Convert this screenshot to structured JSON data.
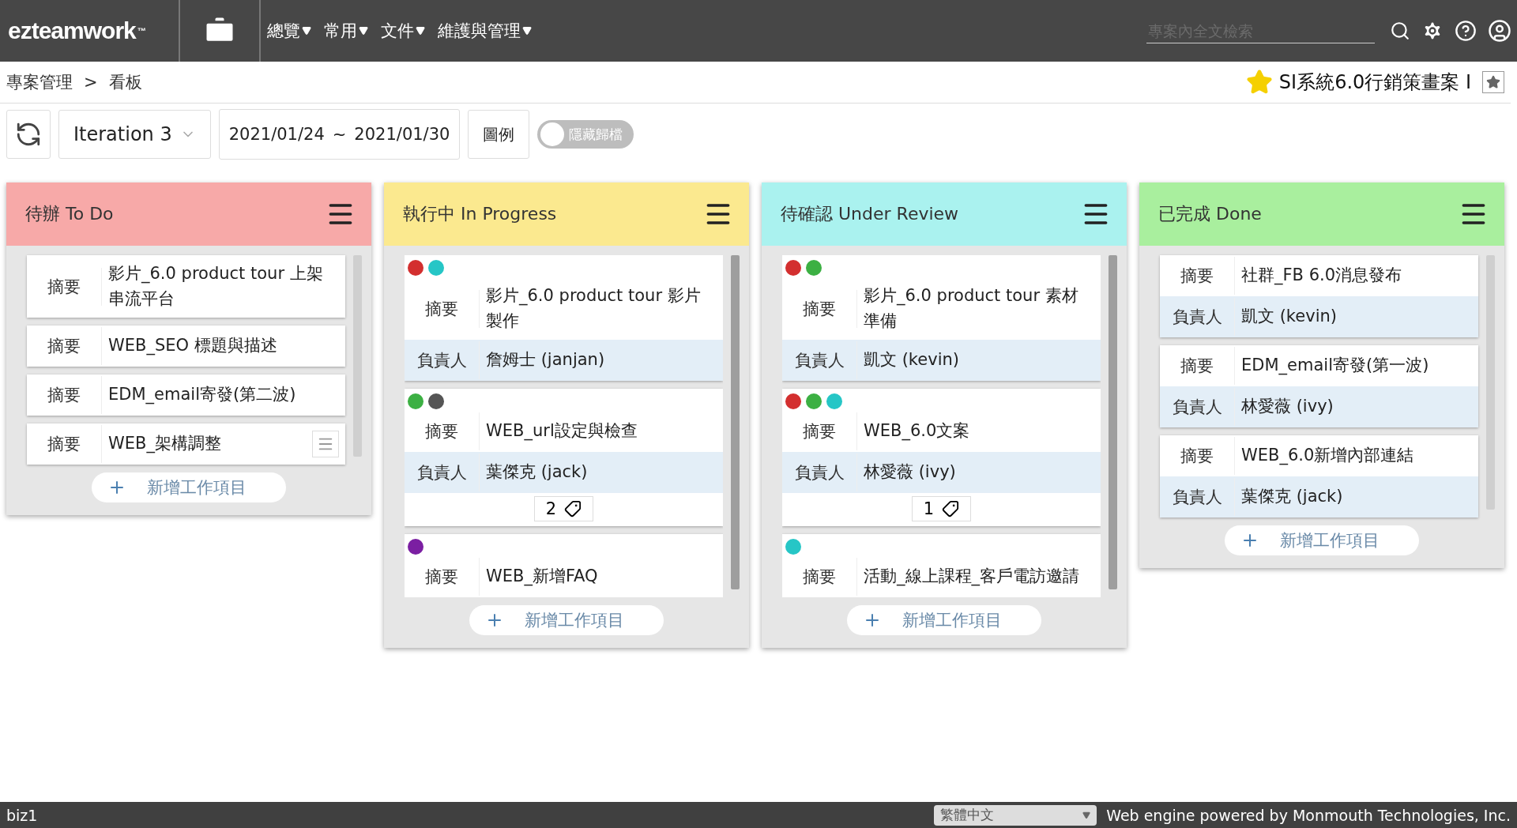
{
  "header": {
    "logo": "ezteamwork",
    "logo_mark": "™",
    "menu": [
      {
        "label": "總覽"
      },
      {
        "label": "常用"
      },
      {
        "label": "文件"
      },
      {
        "label": "維護與管理"
      }
    ],
    "search": {
      "placeholder": "專案內全文檢索"
    }
  },
  "breadcrumb": {
    "items": [
      "專案管理",
      "看板"
    ],
    "separator": ">"
  },
  "project": {
    "title": "SI系統6.0行銷策畫案 I",
    "starred": true
  },
  "toolbar": {
    "iteration": "Iteration 3",
    "date_start": "2021/01/24",
    "date_sep": "~",
    "date_end": "2021/01/30",
    "legend_button": "圖例",
    "archive_toggle": {
      "label": "隱藏歸檔",
      "on": false
    }
  },
  "columns": [
    {
      "title": "待辦 To Do",
      "color": "#f7a9a8",
      "scrolled": false,
      "add_label": "新增工作項目",
      "cards": [
        {
          "fields": [
            {
              "kind": "summary",
              "label": "摘要",
              "value": "影片_6.0 product tour 上架串流平台"
            }
          ]
        },
        {
          "fields": [
            {
              "kind": "summary",
              "label": "摘要",
              "value": "WEB_SEO 標題與描述"
            }
          ]
        },
        {
          "fields": [
            {
              "kind": "summary",
              "label": "摘要",
              "value": "EDM_email寄發(第二波)"
            }
          ]
        },
        {
          "menu": true,
          "fields": [
            {
              "kind": "summary",
              "label": "摘要",
              "value": "WEB_架構調整"
            }
          ]
        }
      ]
    },
    {
      "title": "執行中 In Progress",
      "color": "#fbe98f",
      "scrolled": true,
      "add_label": "新增工作項目",
      "cards": [
        {
          "dots": [
            {
              "color": "#d32f2f"
            },
            {
              "color": "#26c6c6"
            }
          ],
          "fields": [
            {
              "kind": "summary",
              "label": "摘要",
              "value": "影片_6.0 product tour 影片製作"
            },
            {
              "kind": "owner",
              "label": "負責人",
              "value": "詹姆士 (janjan)"
            }
          ]
        },
        {
          "dots": [
            {
              "color": "#3cb043"
            },
            {
              "color": "#555555"
            }
          ],
          "tag_count": "2",
          "fields": [
            {
              "kind": "summary",
              "label": "摘要",
              "value": "WEB_url設定與檢查"
            },
            {
              "kind": "owner",
              "label": "負責人",
              "value": "葉傑克 (jack)"
            }
          ]
        },
        {
          "dots": [
            {
              "color": "#7b1fa2"
            }
          ],
          "fields": [
            {
              "kind": "summary",
              "label": "摘要",
              "value": "WEB_新增FAQ"
            }
          ]
        }
      ]
    },
    {
      "title": "待確認 Under Review",
      "color": "#aaf2ef",
      "scrolled": true,
      "add_label": "新增工作項目",
      "cards": [
        {
          "dots": [
            {
              "color": "#d32f2f"
            },
            {
              "color": "#3cb043"
            }
          ],
          "fields": [
            {
              "kind": "summary",
              "label": "摘要",
              "value": "影片_6.0 product tour 素材準備"
            },
            {
              "kind": "owner",
              "label": "負責人",
              "value": "凱文 (kevin)"
            }
          ]
        },
        {
          "dots": [
            {
              "color": "#d32f2f"
            },
            {
              "color": "#3cb043"
            },
            {
              "color": "#26c6c6"
            }
          ],
          "tag_count": "1",
          "fields": [
            {
              "kind": "summary",
              "label": "摘要",
              "value": "WEB_6.0文案"
            },
            {
              "kind": "owner",
              "label": "負責人",
              "value": "林愛薇 (ivy)"
            }
          ]
        },
        {
          "dots": [
            {
              "color": "#26c6c6"
            }
          ],
          "fields": [
            {
              "kind": "summary",
              "label": "摘要",
              "value": "活動_線上課程_客戶電訪邀請"
            }
          ]
        }
      ]
    },
    {
      "title": "已完成 Done",
      "color": "#a9ef9e",
      "scrolled": false,
      "add_label": "新增工作項目",
      "cards": [
        {
          "fields": [
            {
              "kind": "summary",
              "label": "摘要",
              "value": "社群_FB 6.0消息發布"
            },
            {
              "kind": "owner",
              "label": "負責人",
              "value": "凱文 (kevin)"
            }
          ]
        },
        {
          "fields": [
            {
              "kind": "summary",
              "label": "摘要",
              "value": "EDM_email寄發(第一波)"
            },
            {
              "kind": "owner",
              "label": "負責人",
              "value": "林愛薇 (ivy)"
            }
          ]
        },
        {
          "fields": [
            {
              "kind": "summary",
              "label": "摘要",
              "value": "WEB_6.0新增內部連結"
            },
            {
              "kind": "owner",
              "label": "負責人",
              "value": "葉傑克 (jack)"
            }
          ]
        }
      ]
    }
  ],
  "footer": {
    "user": "biz1",
    "language": "繁體中文",
    "credit": "Web engine powered by Monmouth Technologies, Inc."
  }
}
